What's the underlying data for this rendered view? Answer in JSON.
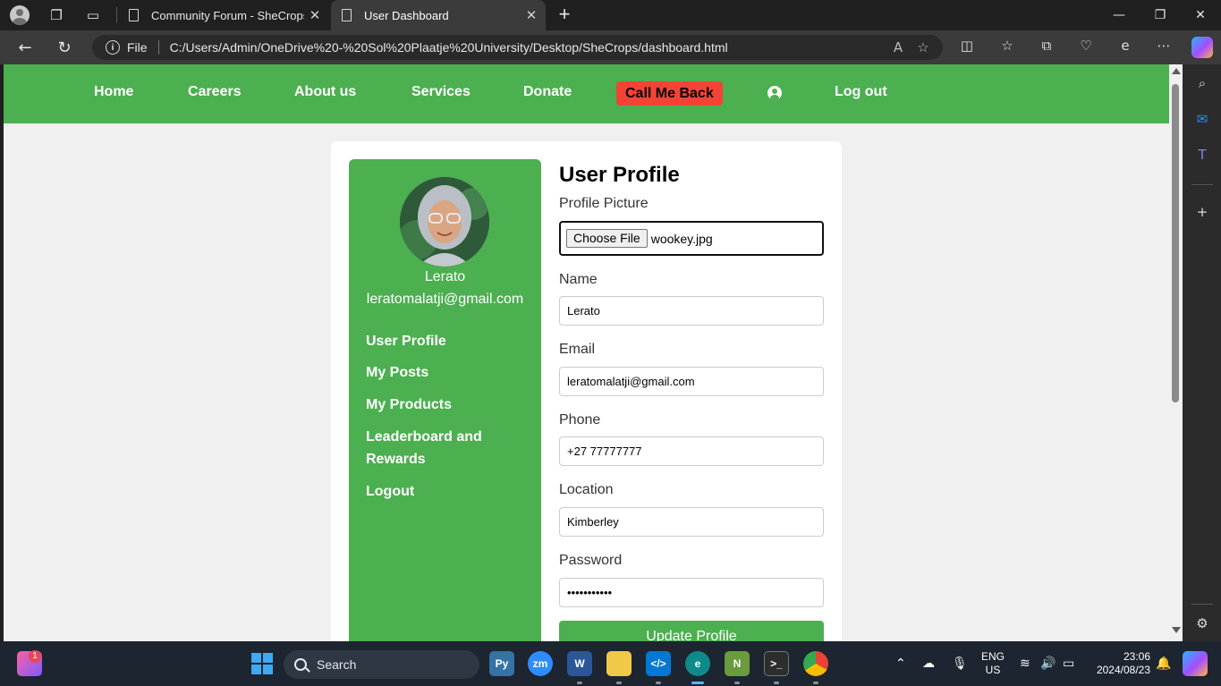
{
  "browser": {
    "tabs": [
      {
        "title": "Community Forum - SheCrops",
        "active": false
      },
      {
        "title": "User Dashboard",
        "active": true
      }
    ],
    "address": {
      "scheme_label": "File",
      "url": "C:/Users/Admin/OneDrive%20-%20Sol%20Plaatje%20University/Desktop/SheCrops/dashboard.html"
    }
  },
  "site_nav": {
    "items": [
      "Home",
      "Careers",
      "About us",
      "Services",
      "Donate"
    ],
    "call_me_back": "Call Me Back",
    "logout": "Log out"
  },
  "sidebar": {
    "name": "Lerato",
    "email": "leratomalatji@gmail.com",
    "links": [
      "User Profile",
      "My Posts",
      "My Products",
      "Leaderboard and Rewards",
      "Logout"
    ]
  },
  "profile_form": {
    "title": "User Profile",
    "picture_label": "Profile Picture",
    "choose_file": "Choose File",
    "file_name": "wookey.jpg",
    "fields": [
      {
        "label": "Name",
        "value": "Lerato"
      },
      {
        "label": "Email",
        "value": "leratomalatji@gmail.com"
      },
      {
        "label": "Phone",
        "value": "+27 77777777"
      },
      {
        "label": "Location",
        "value": "Kimberley"
      },
      {
        "label": "Password",
        "value": "•••••••••••"
      }
    ],
    "submit": "Update Profile"
  },
  "taskbar": {
    "search_placeholder": "Search",
    "language": "ENG",
    "region": "US",
    "time": "23:06",
    "date": "2024/08/23",
    "notification_badge": "1"
  },
  "colors": {
    "brand_green": "#4caf50",
    "call_red": "#f44336"
  }
}
